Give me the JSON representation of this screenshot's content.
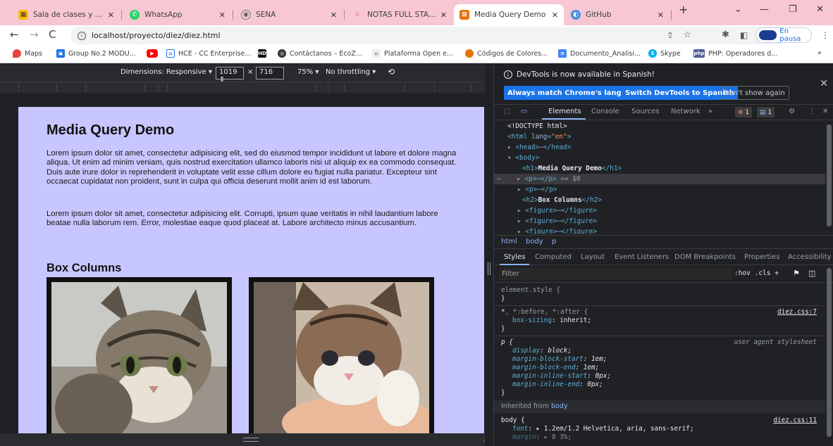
{
  "browser": {
    "tabs": [
      {
        "label": "Sala de clases y tallere",
        "icon": "classroom-icon",
        "active": false
      },
      {
        "label": "WhatsApp",
        "icon": "whatsapp-icon",
        "active": false
      },
      {
        "label": "SENA",
        "icon": "sena-icon",
        "active": false
      },
      {
        "label": "NOTAS FULL STACK TA",
        "icon": "notion-icon",
        "active": false
      },
      {
        "label": "Media Query Demo",
        "icon": "page-icon",
        "active": true
      },
      {
        "label": "GitHub",
        "icon": "github-icon",
        "active": false
      }
    ],
    "new_tab": "+",
    "window_controls": {
      "dropdown": "⌄",
      "minimize": "—",
      "restore": "❐",
      "close": "✕"
    },
    "url": "localhost/proyecto/diez/diez.html",
    "profile_status": "En pausa",
    "bookmarks": [
      {
        "label": "Maps",
        "icon": "maps-icon",
        "color": "#e8453c"
      },
      {
        "label": "Group No.2 MODU...",
        "icon": "group-icon",
        "color": "#1a73e8"
      },
      {
        "label": "",
        "icon": "youtube-icon",
        "color": "#ff0000"
      },
      {
        "label": "HCE - CC Enterprise...",
        "icon": "hce-icon",
        "color": "#1a73e8"
      },
      {
        "label": "",
        "icon": "hd-icon",
        "color": "#111111"
      },
      {
        "label": "Contáctanos – EcoZ...",
        "icon": "ecoz-icon",
        "color": "#333333"
      },
      {
        "label": "Plataforma Open e...",
        "icon": "platform-icon",
        "color": "#777777"
      },
      {
        "label": "Códigos de Colores...",
        "icon": "colors-icon",
        "color": "#e37400"
      },
      {
        "label": "Documento_Analisi...",
        "icon": "docs-icon",
        "color": "#4285f4"
      },
      {
        "label": "Skype",
        "icon": "skype-icon",
        "color": "#00aff0"
      },
      {
        "label": "PHP: Operadores d...",
        "icon": "php-icon",
        "color": "#4f5b93"
      }
    ],
    "bookmarks_more": "»"
  },
  "device_toolbar": {
    "dimensions_label": "Dimensions: Responsive ▾",
    "width": "1019",
    "times": "×",
    "height": "716",
    "zoom": "75% ▾",
    "throttling": "No throttling ▾"
  },
  "page": {
    "h1": "Media Query Demo",
    "p1": "Lorem ipsum dolor sit amet, consectetur adipisicing elit, sed do eiusmod tempor incididunt ut labore et dolore magna aliqua. Ut enim ad minim veniam, quis nostrud exercitation ullamco laboris nisi ut aliquip ex ea commodo consequat. Duis aute irure dolor in reprehenderit in voluptate velit esse cillum dolore eu fugiat nulla pariatur. Excepteur sint occaecat cupidatat non proident, sunt in culpa qui officia deserunt mollit anim id est laborum.",
    "p2": "Lorem ipsum dolor sit amet, consectetur adipisicing elit. Corrupti, ipsum quae veritatis in nihil laudantium labore beatae nulla laborum rem. Error, molestiae eaque quod placeat at. Labore architecto minus accusantium.",
    "h2": "Box Columns",
    "background_color": "#c8c6ff"
  },
  "devtools": {
    "info_message": "DevTools is now available in Spanish!",
    "btn_match": "Always match Chrome's language",
    "btn_switch": "Switch DevTools to Spanish",
    "btn_dismiss": "Don't show again",
    "tabs": [
      "Elements",
      "Console",
      "Sources",
      "Network",
      "»"
    ],
    "errors_count": "1",
    "messages_count": "1",
    "dom": {
      "doctype": "<!DOCTYPE html>",
      "html_open": "<html lang=\"en\">",
      "head": "<head>",
      "head_close": "</head>",
      "body": "<body>",
      "h1_text": "Media Query Demo",
      "selected_suffix": "== $0",
      "h2_text": "Box Columns",
      "ellipsis": "⋯"
    },
    "breadcrumbs": [
      "html",
      "body",
      "p"
    ],
    "styles_tabs": [
      "Styles",
      "Computed",
      "Layout",
      "Event Listeners",
      "DOM Breakpoints",
      "Properties",
      "Accessibility"
    ],
    "filter_placeholder": "Filter",
    "filter_tools": ":hov  .cls  +",
    "rules": {
      "element_style": "element.style {",
      "close_brace": "}",
      "universal_selector": "*, *:before, *:after {",
      "universal_selector_main": "*",
      "universal_selector_rest": ", *:before, *:after {",
      "universal_src": "diez.css:7",
      "box_sizing_prop": "box-sizing",
      "box_sizing_val": "inherit;",
      "p_selector": "p {",
      "ua_label": "user agent stylesheet",
      "p_props": [
        {
          "prop": "display",
          "val": "block;"
        },
        {
          "prop": "margin-block-start",
          "val": "1em;"
        },
        {
          "prop": "margin-block-end",
          "val": "1em;"
        },
        {
          "prop": "margin-inline-start",
          "val": "0px;"
        },
        {
          "prop": "margin-inline-end",
          "val": "0px;"
        }
      ],
      "inherited_from": "Inherited from",
      "inherited_el": "body",
      "body_selector": "body {",
      "body_src": "diez.css:11",
      "font_prop": "font",
      "font_val": "▸ 1.2em/1.2 Helvetica, aria, sans-serif;",
      "margin_prop": "margin",
      "margin_val": "▸ 0 3%;"
    }
  }
}
